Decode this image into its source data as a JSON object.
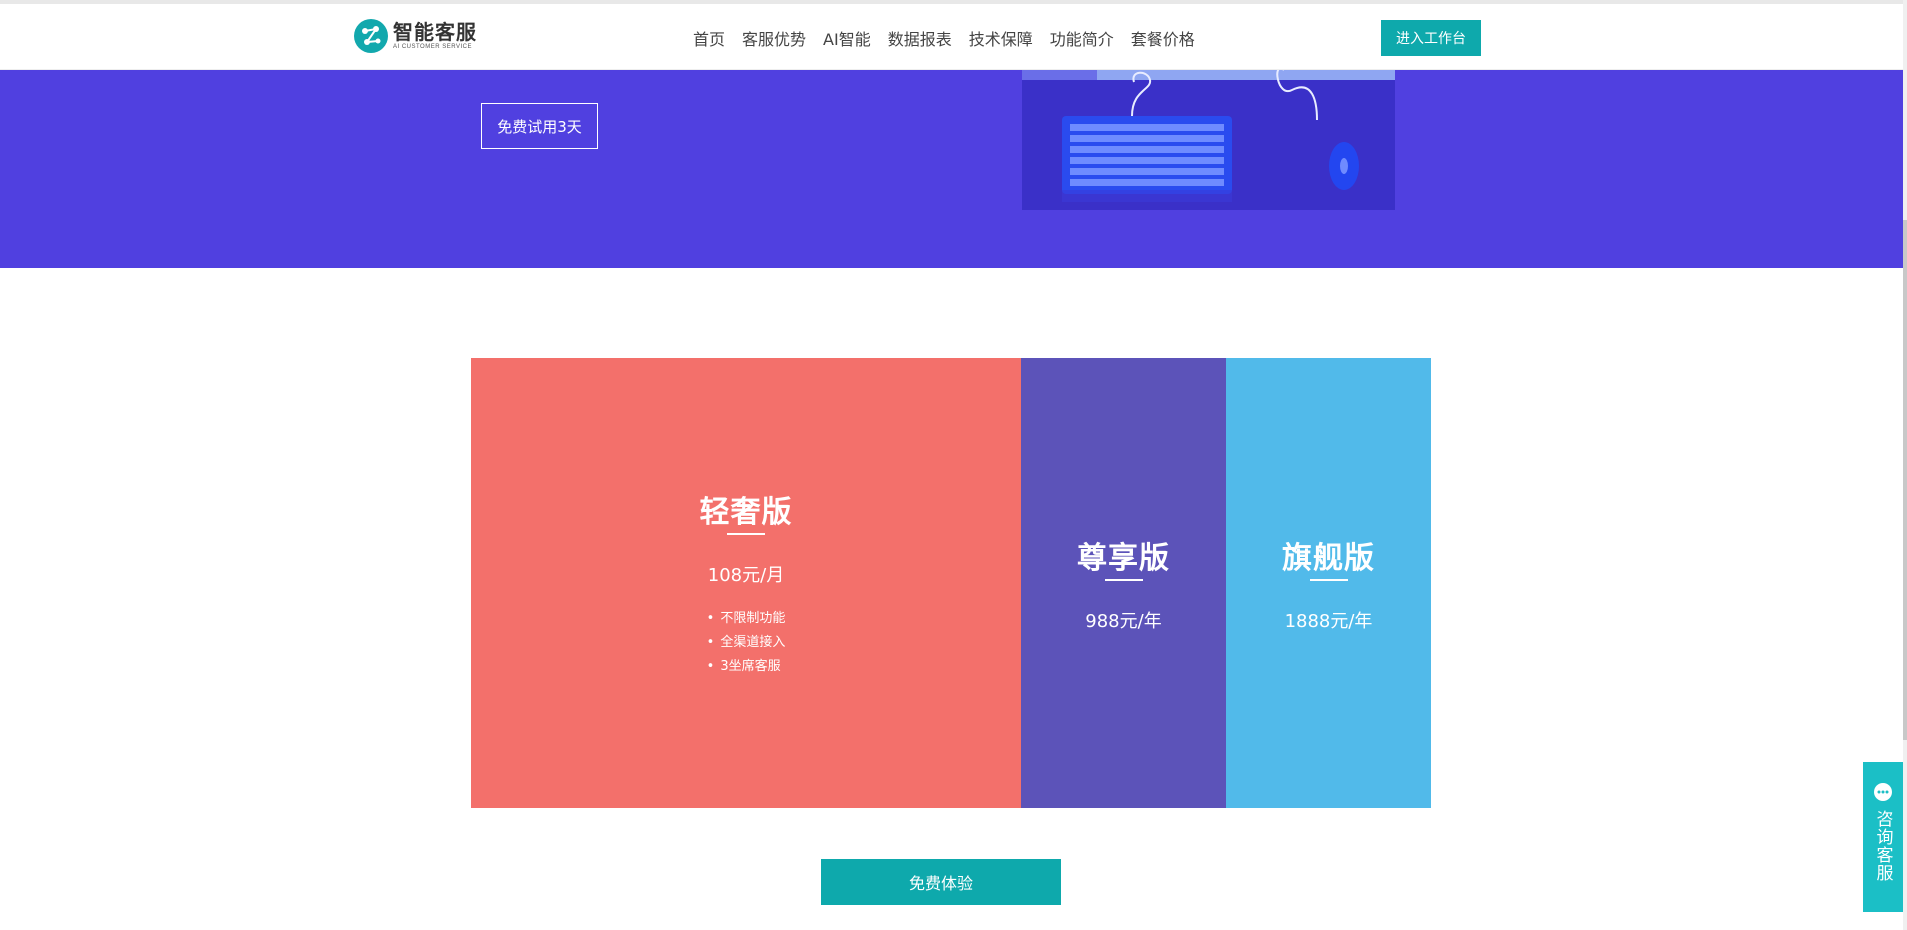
{
  "header": {
    "logo_title": "智能客服",
    "logo_subtitle": "AI CUSTOMER SERVICE",
    "nav": [
      "首页",
      "客服优势",
      "AI智能",
      "数据报表",
      "技术保障",
      "功能简介",
      "套餐价格"
    ],
    "workspace_label": "进入工作台"
  },
  "hero": {
    "trial_label": "免费试用3天"
  },
  "plans": {
    "light": {
      "title": "轻奢版",
      "price": "108元/月",
      "features": [
        "不限制功能",
        "全渠道接入",
        "3坐席客服"
      ],
      "color": "#f3706b"
    },
    "vip": {
      "title": "尊享版",
      "price": "988元/年",
      "color": "#5c53b9"
    },
    "flagship": {
      "title": "旗舰版",
      "price": "1888元/年",
      "color": "#51baea"
    }
  },
  "cta": {
    "experience_label": "免费体验"
  },
  "consult": {
    "label": "咨询客服",
    "icon": "chat-bubble-icon"
  },
  "colors": {
    "brand_teal": "#0ea9ac",
    "hero_bg": "#5040e0"
  }
}
